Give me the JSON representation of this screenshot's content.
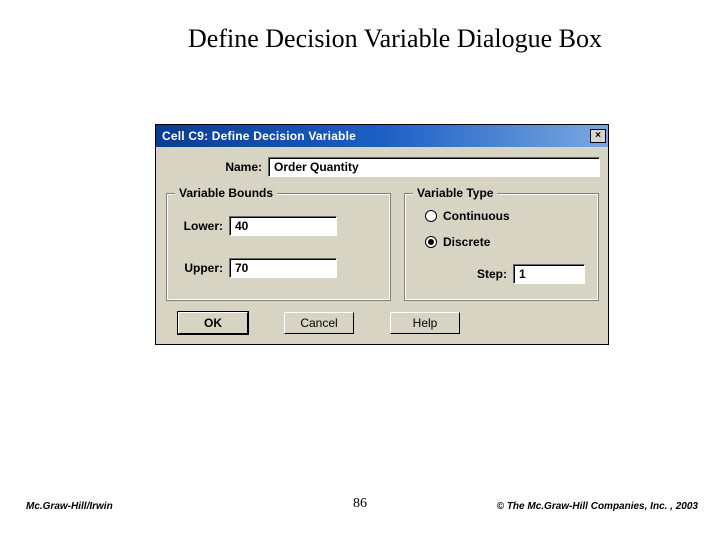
{
  "slide": {
    "title": "Define Decision Variable Dialogue Box"
  },
  "window": {
    "title": "Cell C9: Define Decision Variable",
    "close_glyph": "×"
  },
  "name_row": {
    "label": "Name:",
    "value": "Order Quantity"
  },
  "bounds": {
    "legend": "Variable Bounds",
    "lower_label": "Lower:",
    "lower_value": "40",
    "upper_label": "Upper:",
    "upper_value": "70"
  },
  "vtype": {
    "legend": "Variable Type",
    "continuous_label": "Continuous",
    "continuous_selected": false,
    "discrete_label": "Discrete",
    "discrete_selected": true,
    "step_label": "Step:",
    "step_value": "1"
  },
  "buttons": {
    "ok": "OK",
    "cancel": "Cancel",
    "help": "Help"
  },
  "footer": {
    "left": "Mc.Graw-Hill/Irwin",
    "page": "86",
    "right": "© The Mc.Graw-Hill Companies, Inc. , 2003"
  }
}
